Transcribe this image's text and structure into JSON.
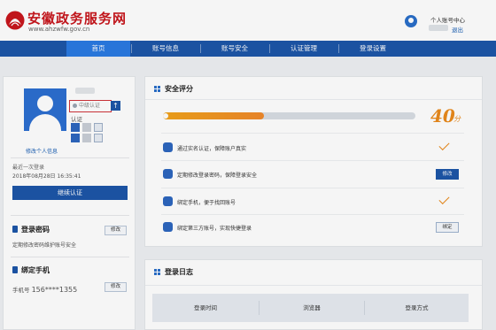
{
  "header": {
    "site_title": "安徽政务服务网",
    "site_url": "www.ahzwfw.gov.cn",
    "user_center": "个人账号中心",
    "logout": "退出"
  },
  "nav": {
    "items": [
      "首页",
      "账号信息",
      "账号安全",
      "认证管理",
      "登录设置"
    ],
    "active_index": 0
  },
  "profile": {
    "level": "中级认证",
    "auth_label": "认证",
    "edit_info": "修改个人信息",
    "last_login_label": "最近一次登录",
    "last_login_time": "2018年08月28日 16:35:41",
    "continue_auth": "继续认证"
  },
  "password_section": {
    "title": "登录密码",
    "desc": "定期修改密码维护账号安全",
    "button": "修改"
  },
  "phone_section": {
    "title": "绑定手机",
    "label": "手机号",
    "number": "156****1355",
    "button": "修改"
  },
  "security": {
    "title": "安全评分",
    "score": "40",
    "score_unit": "分",
    "progress_fraction": 0.4,
    "items": [
      {
        "text": "通过实名认证，保障账户真实",
        "action": "check"
      },
      {
        "text": "定期修改登录密码，保障登录安全",
        "action": "修改"
      },
      {
        "text": "绑定手机，便于找回账号",
        "action": "check"
      },
      {
        "text": "绑定第三方账号，实现快捷登录",
        "action": "绑定"
      }
    ]
  },
  "login_log": {
    "title": "登录日志",
    "columns": [
      "登录时间",
      "浏览器",
      "登录方式"
    ]
  },
  "colors": {
    "brand_red": "#c8161d",
    "nav_blue": "#1d56a8",
    "nav_active": "#2a7ae2",
    "accent_orange": "#ea8a1c"
  }
}
